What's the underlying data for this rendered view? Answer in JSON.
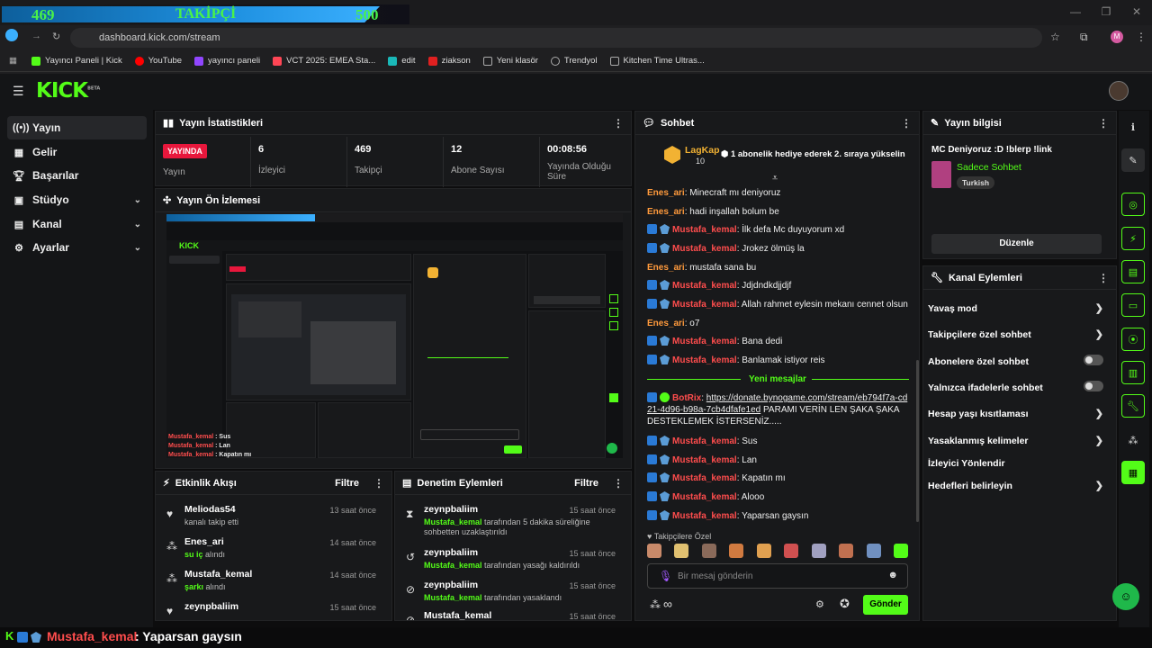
{
  "browser": {
    "follow_goal": {
      "current": "469",
      "label": "TAKİPÇİ",
      "target": "500"
    },
    "url": "dashboard.kick.com/stream",
    "bookmarks": [
      "Yayıncı Paneli | Kick",
      "YouTube",
      "yayıncı paneli",
      "VCT 2025: EMEA Sta...",
      "edit",
      "ziakson",
      "Yeni klasör",
      "Trendyol",
      "Kitchen Time Ultras..."
    ],
    "profile_initial": "M"
  },
  "kick": {
    "logo": "KICK",
    "logo_sup": "BETA"
  },
  "sidebar": {
    "items": [
      {
        "label": "Yayın",
        "icon": "broadcast-icon"
      },
      {
        "label": "Gelir",
        "icon": "revenue-icon"
      },
      {
        "label": "Başarılar",
        "icon": "trophy-icon"
      },
      {
        "label": "Stüdyo",
        "icon": "studio-icon"
      },
      {
        "label": "Kanal",
        "icon": "channel-icon"
      },
      {
        "label": "Ayarlar",
        "icon": "gear-icon"
      }
    ]
  },
  "stats": {
    "title": "Yayın İstatistikleri",
    "live_badge": "YAYINDA",
    "items": [
      {
        "label": "Yayın",
        "value": ""
      },
      {
        "label": "İzleyici",
        "value": "6"
      },
      {
        "label": "Takipçi",
        "value": "469"
      },
      {
        "label": "Abone Sayısı",
        "value": "12"
      },
      {
        "label": "Yayında Olduğu Süre",
        "value": "00:08:56"
      }
    ]
  },
  "preview": {
    "title": "Yayın Ön İzlemesi"
  },
  "events": {
    "title": "Etkinlik Akışı",
    "filter": "Filtre",
    "items": [
      {
        "name": "Meliodas54",
        "sub": "kanalı takip etti",
        "time": "13 saat önce"
      },
      {
        "name": "Enes_ari",
        "highlight": "su iç",
        "sub": " alındı",
        "time": "14 saat önce"
      },
      {
        "name": "Mustafa_kemal",
        "highlight": "şarkı",
        "sub": " alındı",
        "time": "14 saat önce"
      },
      {
        "name": "zeynpbaliim",
        "sub": "",
        "time": "15 saat önce"
      }
    ]
  },
  "moderation": {
    "title": "Denetim Eylemleri",
    "filter": "Filtre",
    "items": [
      {
        "name": "zeynpbaliim",
        "highlight": "Mustafa_kemal",
        "sub": " tarafından 5 dakika süreliğine sohbetten uzaklaştırıldı",
        "time": "15 saat önce"
      },
      {
        "name": "zeynpbaliim",
        "highlight": "Mustafa_kemal",
        "sub": " tarafından yasağı kaldırıldı",
        "time": "15 saat önce"
      },
      {
        "name": "zeynpbaliim",
        "highlight": "Mustafa_kemal",
        "sub": " tarafından yasaklandı",
        "time": "15 saat önce"
      },
      {
        "name": "Mustafa_kemal",
        "sub": "",
        "time": "15 saat önce"
      }
    ]
  },
  "chat": {
    "title": "Sohbet",
    "pinned": {
      "user": "LagKap",
      "count": "10",
      "text": "1 abonelik hediye ederek 2. sıraya yükselin"
    },
    "messages": [
      {
        "user": "Enes_ari",
        "color": "orange",
        "text": "Minecraft mı deniyoruz",
        "badges": false
      },
      {
        "user": "Enes_ari",
        "color": "orange",
        "text": "hadi inşallah bolum be",
        "badges": false
      },
      {
        "user": "Mustafa_kemal",
        "color": "red",
        "text": "İlk defa Mc duyuyorum xd",
        "badges": true
      },
      {
        "user": "Mustafa_kemal",
        "color": "red",
        "text": "Jrokez ölmüş la",
        "badges": true
      },
      {
        "user": "Enes_ari",
        "color": "orange",
        "text": "mustafa sana bu",
        "badges": false
      },
      {
        "user": "Mustafa_kemal",
        "color": "red",
        "text": "Jdjdndkdjjdjf",
        "badges": true
      },
      {
        "user": "Mustafa_kemal",
        "color": "red",
        "text": "Allah rahmet eylesin mekanı cennet olsun",
        "badges": true
      },
      {
        "user": "Enes_ari",
        "color": "orange",
        "text": "o7",
        "badges": false
      },
      {
        "user": "Mustafa_kemal",
        "color": "red",
        "text": "Bana dedi",
        "badges": true
      },
      {
        "user": "Mustafa_kemal",
        "color": "red",
        "text": "Banlamak istiyor reis",
        "badges": true
      }
    ],
    "new_messages": "Yeni mesajlar",
    "bot": {
      "user": "BotRix",
      "link": "https://donate.bynogame.com/stream/eb794f7a-cd21-4d96-b98a-7cb4dfafe1ed",
      "text": " PARAMI VERİN LEN ŞAKA ŞAKA DESTEKLEMEK İSTERSENİZ....."
    },
    "after": [
      {
        "user": "Mustafa_kemal",
        "text": "Sus"
      },
      {
        "user": "Mustafa_kemal",
        "text": "Lan"
      },
      {
        "user": "Mustafa_kemal",
        "text": "Kapatın mı"
      },
      {
        "user": "Mustafa_kemal",
        "text": "Alooo"
      },
      {
        "user": "Mustafa_kemal",
        "text": "Yaparsan gaysın"
      }
    ],
    "followers_only": "Takipçilere Özel",
    "placeholder": "Bir mesaj gönderin",
    "send": "Gönder",
    "infinity": "∞"
  },
  "stream_info": {
    "title": "Yayın bilgisi",
    "stream_title": "MC Deniyoruz :D !blerp !link",
    "category": "Sadece Sohbet",
    "tag": "Turkish",
    "edit": "Düzenle"
  },
  "channel_actions": {
    "title": "Kanal Eylemleri",
    "items": [
      {
        "label": "Yavaş mod",
        "type": "arrow"
      },
      {
        "label": "Takipçilere özel sohbet",
        "type": "arrow"
      },
      {
        "label": "Abonelere özel sohbet",
        "type": "toggle"
      },
      {
        "label": "Yalnızca ifadelerle sohbet",
        "type": "toggle"
      },
      {
        "label": "Hesap yaşı kısıtlaması",
        "type": "arrow"
      },
      {
        "label": "Yasaklanmış kelimeler",
        "type": "arrow"
      },
      {
        "label": "İzleyici Yönlendir",
        "type": "none"
      },
      {
        "label": "Hedefleri belirleyin",
        "type": "arrow"
      }
    ]
  },
  "overlay": {
    "user": "Mustafa_kemal",
    "text": ": Yaparsan gaysın"
  }
}
